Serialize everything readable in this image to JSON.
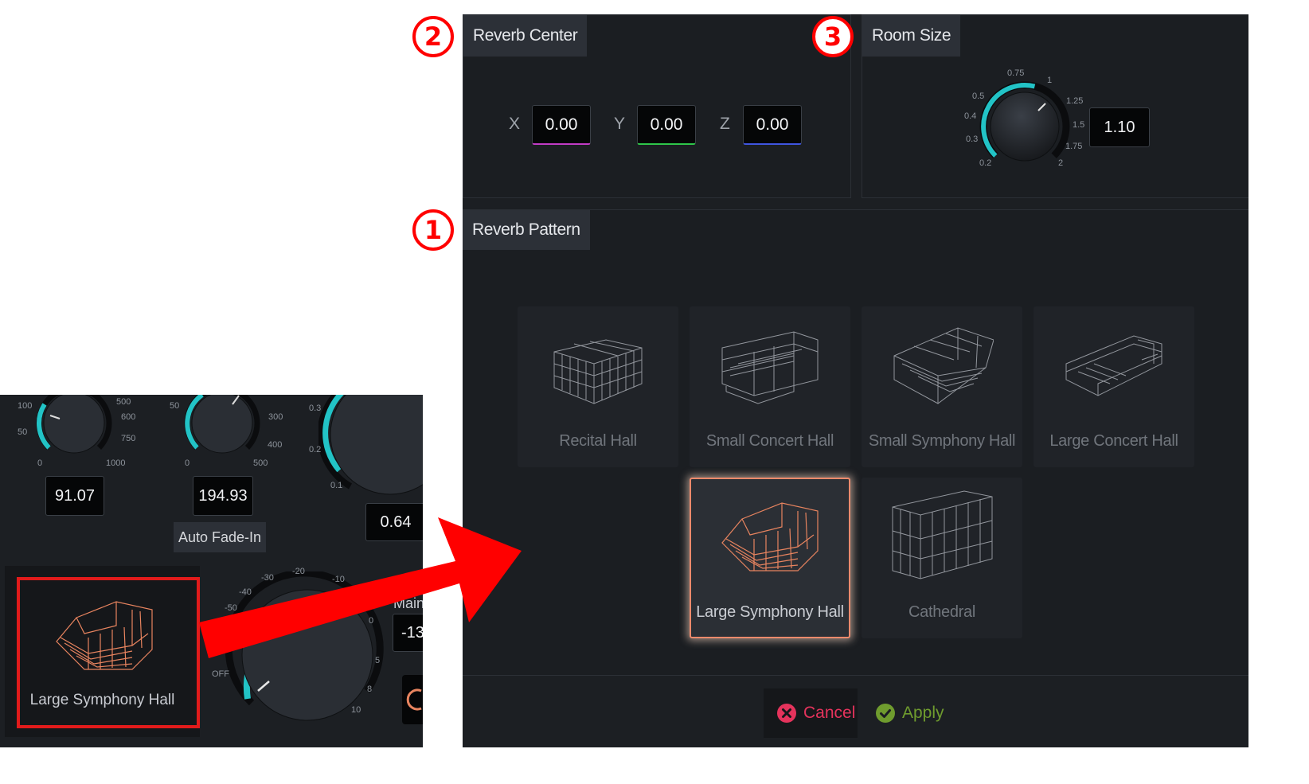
{
  "reverb_center": {
    "title": "Reverb Center",
    "x_label": "X",
    "x_value": "0.00",
    "y_label": "Y",
    "y_value": "0.00",
    "z_label": "Z",
    "z_value": "0.00"
  },
  "room_size": {
    "title": "Room Size",
    "value": "1.10",
    "ticks": [
      "0.75",
      "1",
      "0.5",
      "1.25",
      "0.4",
      "1.5",
      "0.3",
      "1.75",
      "0.2",
      "2"
    ]
  },
  "reverb_pattern": {
    "title": "Reverb Pattern",
    "options": [
      {
        "label": "Recital Hall",
        "selected": false
      },
      {
        "label": "Small Concert Hall",
        "selected": false
      },
      {
        "label": "Small Symphony Hall",
        "selected": false
      },
      {
        "label": "Large Concert Hall",
        "selected": false
      },
      {
        "label": "Large Symphony Hall",
        "selected": true
      },
      {
        "label": "Cathedral",
        "selected": false
      }
    ]
  },
  "footer": {
    "cancel_label": "Cancel",
    "apply_label": "Apply"
  },
  "callouts": {
    "one": "1",
    "two": "2",
    "three": "3"
  },
  "inset": {
    "knob1": {
      "value": "91.07",
      "ticks": [
        "100",
        "500",
        "600",
        "50",
        "750",
        "0",
        "1000"
      ]
    },
    "knob2": {
      "value": "194.93",
      "ticks": [
        "50",
        "300",
        "400",
        "0",
        "500"
      ],
      "caption": "Auto Fade-In"
    },
    "knob3": {
      "value": "0.64",
      "ticks": [
        "0.3",
        "0.2",
        "0.1"
      ]
    },
    "selected_pattern": "Large Symphony Hall",
    "main_knob": {
      "ticks": [
        "-30",
        "-20",
        "-10",
        "-40",
        "-50",
        "0",
        "5",
        "OFF",
        "8",
        "10"
      ]
    },
    "main_label": "Main",
    "main_value": "-13"
  },
  "colors": {
    "accent_teal": "#22c3c6",
    "selection_orange": "#ef8a6c",
    "callout_red": "#ff0000",
    "cancel_red": "#e5335c",
    "apply_green": "#6f9c2e",
    "x_underline": "#c23cc6",
    "y_underline": "#2fc64a",
    "z_underline": "#3f55e0"
  }
}
